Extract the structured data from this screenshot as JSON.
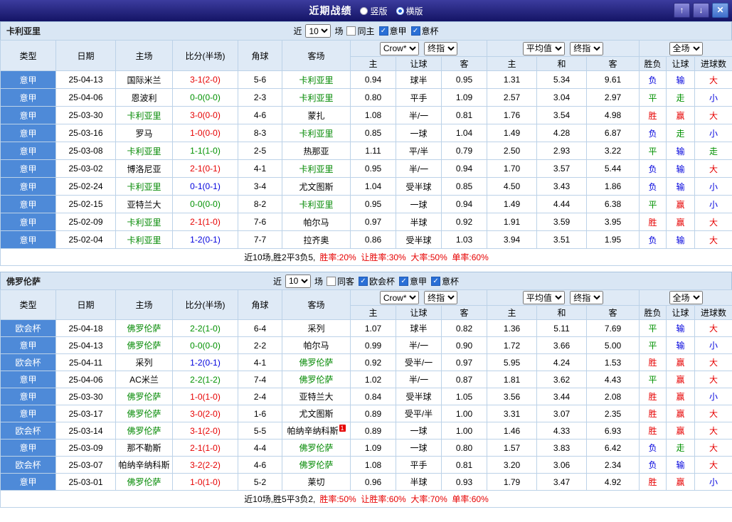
{
  "topbar": {
    "title": "近期战绩",
    "vertical_label": "竖版",
    "horizontal_label": "横版",
    "selected_layout": "横版",
    "up_glyph": "↑",
    "down_glyph": "↓",
    "close_glyph": "✕"
  },
  "table": {
    "col_headers": {
      "type": "类型",
      "date": "日期",
      "home": "主场",
      "score": "比分(半场)",
      "corner": "角球",
      "away": "客场"
    },
    "sub_headers": [
      "主",
      "让球",
      "客",
      "主",
      "和",
      "客",
      "胜负",
      "让球",
      "进球数"
    ],
    "selects": {
      "company": "Crow*",
      "final_a": "终指",
      "average": "平均值",
      "final_b": "终指",
      "scope": "全场"
    },
    "filter": {
      "near": "近",
      "matches": "场"
    }
  },
  "colors": {
    "red": "#e60000",
    "green": "#009100",
    "blue": "#0000dd",
    "team": "#008800",
    "league_bg": "#4e8ad8"
  },
  "sections": [
    {
      "team": "卡利亚里",
      "filter_count": "10",
      "checkboxes": [
        {
          "label": "同主",
          "checked": false
        },
        {
          "label": "意甲",
          "checked": true
        },
        {
          "label": "意杯",
          "checked": true
        }
      ],
      "rows": [
        {
          "league": "意甲",
          "date": "25-04-13",
          "home": "国际米兰",
          "home_self": false,
          "score": "3-1(2-0)",
          "result": "home",
          "corner": "5-6",
          "away": "卡利亚里",
          "away_self": true,
          "badge": "",
          "o1": "0.94",
          "hc": "球半",
          "o2": "0.95",
          "a1": "1.31",
          "a2": "5.34",
          "a3": "9.61",
          "r1": "负",
          "r2": "输",
          "r3": "大"
        },
        {
          "league": "意甲",
          "date": "25-04-06",
          "home": "恩波利",
          "home_self": false,
          "score": "0-0(0-0)",
          "result": "draw",
          "corner": "2-3",
          "away": "卡利亚里",
          "away_self": true,
          "badge": "",
          "o1": "0.80",
          "hc": "平手",
          "o2": "1.09",
          "a1": "2.57",
          "a2": "3.04",
          "a3": "2.97",
          "r1": "平",
          "r2": "走",
          "r3": "小"
        },
        {
          "league": "意甲",
          "date": "25-03-30",
          "home": "卡利亚里",
          "home_self": true,
          "score": "3-0(0-0)",
          "result": "home",
          "corner": "4-6",
          "away": "蒙扎",
          "away_self": false,
          "badge": "",
          "o1": "1.08",
          "hc": "半/一",
          "o2": "0.81",
          "a1": "1.76",
          "a2": "3.54",
          "a3": "4.98",
          "r1": "胜",
          "r2": "赢",
          "r3": "大"
        },
        {
          "league": "意甲",
          "date": "25-03-16",
          "home": "罗马",
          "home_self": false,
          "score": "1-0(0-0)",
          "result": "home",
          "corner": "8-3",
          "away": "卡利亚里",
          "away_self": true,
          "badge": "",
          "o1": "0.85",
          "hc": "一球",
          "o2": "1.04",
          "a1": "1.49",
          "a2": "4.28",
          "a3": "6.87",
          "r1": "负",
          "r2": "走",
          "r3": "小"
        },
        {
          "league": "意甲",
          "date": "25-03-08",
          "home": "卡利亚里",
          "home_self": true,
          "score": "1-1(1-0)",
          "result": "draw",
          "corner": "2-5",
          "away": "热那亚",
          "away_self": false,
          "badge": "",
          "o1": "1.11",
          "hc": "平/半",
          "o2": "0.79",
          "a1": "2.50",
          "a2": "2.93",
          "a3": "3.22",
          "r1": "平",
          "r2": "输",
          "r3": "走"
        },
        {
          "league": "意甲",
          "date": "25-03-02",
          "home": "博洛尼亚",
          "home_self": false,
          "score": "2-1(0-1)",
          "result": "home",
          "corner": "4-1",
          "away": "卡利亚里",
          "away_self": true,
          "badge": "",
          "o1": "0.95",
          "hc": "半/一",
          "o2": "0.94",
          "a1": "1.70",
          "a2": "3.57",
          "a3": "5.44",
          "r1": "负",
          "r2": "输",
          "r3": "大"
        },
        {
          "league": "意甲",
          "date": "25-02-24",
          "home": "卡利亚里",
          "home_self": true,
          "score": "0-1(0-1)",
          "result": "away",
          "corner": "3-4",
          "away": "尤文图斯",
          "away_self": false,
          "badge": "",
          "o1": "1.04",
          "hc": "受半球",
          "o2": "0.85",
          "a1": "4.50",
          "a2": "3.43",
          "a3": "1.86",
          "r1": "负",
          "r2": "输",
          "r3": "小"
        },
        {
          "league": "意甲",
          "date": "25-02-15",
          "home": "亚特兰大",
          "home_self": false,
          "score": "0-0(0-0)",
          "result": "draw",
          "corner": "8-2",
          "away": "卡利亚里",
          "away_self": true,
          "badge": "",
          "o1": "0.95",
          "hc": "一球",
          "o2": "0.94",
          "a1": "1.49",
          "a2": "4.44",
          "a3": "6.38",
          "r1": "平",
          "r2": "赢",
          "r3": "小"
        },
        {
          "league": "意甲",
          "date": "25-02-09",
          "home": "卡利亚里",
          "home_self": true,
          "score": "2-1(1-0)",
          "result": "home",
          "corner": "7-6",
          "away": "帕尔马",
          "away_self": false,
          "badge": "",
          "o1": "0.97",
          "hc": "半球",
          "o2": "0.92",
          "a1": "1.91",
          "a2": "3.59",
          "a3": "3.95",
          "r1": "胜",
          "r2": "赢",
          "r3": "大"
        },
        {
          "league": "意甲",
          "date": "25-02-04",
          "home": "卡利亚里",
          "home_self": true,
          "score": "1-2(0-1)",
          "result": "away",
          "corner": "7-7",
          "away": "拉齐奥",
          "away_self": false,
          "badge": "",
          "o1": "0.86",
          "hc": "受半球",
          "o2": "1.03",
          "a1": "3.94",
          "a2": "3.51",
          "a3": "1.95",
          "r1": "负",
          "r2": "输",
          "r3": "大"
        }
      ],
      "summary_prefix": "近10场,胜2平3负5,",
      "summary_stats": "胜率:20%  让胜率:30%  大率:50%  单率:60%"
    },
    {
      "team": "佛罗伦萨",
      "filter_count": "10",
      "checkboxes": [
        {
          "label": "同客",
          "checked": false
        },
        {
          "label": "欧会杯",
          "checked": true
        },
        {
          "label": "意甲",
          "checked": true
        },
        {
          "label": "意杯",
          "checked": true
        }
      ],
      "rows": [
        {
          "league": "欧会杯",
          "date": "25-04-18",
          "home": "佛罗伦萨",
          "home_self": true,
          "score": "2-2(1-0)",
          "result": "draw",
          "corner": "6-4",
          "away": "采列",
          "away_self": false,
          "badge": "",
          "o1": "1.07",
          "hc": "球半",
          "o2": "0.82",
          "a1": "1.36",
          "a2": "5.11",
          "a3": "7.69",
          "r1": "平",
          "r2": "输",
          "r3": "大"
        },
        {
          "league": "意甲",
          "date": "25-04-13",
          "home": "佛罗伦萨",
          "home_self": true,
          "score": "0-0(0-0)",
          "result": "draw",
          "corner": "2-2",
          "away": "帕尔马",
          "away_self": false,
          "badge": "",
          "o1": "0.99",
          "hc": "半/一",
          "o2": "0.90",
          "a1": "1.72",
          "a2": "3.66",
          "a3": "5.00",
          "r1": "平",
          "r2": "输",
          "r3": "小"
        },
        {
          "league": "欧会杯",
          "date": "25-04-11",
          "home": "采列",
          "home_self": false,
          "score": "1-2(0-1)",
          "result": "away",
          "corner": "4-1",
          "away": "佛罗伦萨",
          "away_self": true,
          "badge": "",
          "o1": "0.92",
          "hc": "受半/一",
          "o2": "0.97",
          "a1": "5.95",
          "a2": "4.24",
          "a3": "1.53",
          "r1": "胜",
          "r2": "赢",
          "r3": "大"
        },
        {
          "league": "意甲",
          "date": "25-04-06",
          "home": "AC米兰",
          "home_self": false,
          "score": "2-2(1-2)",
          "result": "draw",
          "corner": "7-4",
          "away": "佛罗伦萨",
          "away_self": true,
          "badge": "",
          "o1": "1.02",
          "hc": "半/一",
          "o2": "0.87",
          "a1": "1.81",
          "a2": "3.62",
          "a3": "4.43",
          "r1": "平",
          "r2": "赢",
          "r3": "大"
        },
        {
          "league": "意甲",
          "date": "25-03-30",
          "home": "佛罗伦萨",
          "home_self": true,
          "score": "1-0(1-0)",
          "result": "home",
          "corner": "2-4",
          "away": "亚特兰大",
          "away_self": false,
          "badge": "",
          "o1": "0.84",
          "hc": "受半球",
          "o2": "1.05",
          "a1": "3.56",
          "a2": "3.44",
          "a3": "2.08",
          "r1": "胜",
          "r2": "赢",
          "r3": "小"
        },
        {
          "league": "意甲",
          "date": "25-03-17",
          "home": "佛罗伦萨",
          "home_self": true,
          "score": "3-0(2-0)",
          "result": "home",
          "corner": "1-6",
          "away": "尤文图斯",
          "away_self": false,
          "badge": "",
          "o1": "0.89",
          "hc": "受平/半",
          "o2": "1.00",
          "a1": "3.31",
          "a2": "3.07",
          "a3": "2.35",
          "r1": "胜",
          "r2": "赢",
          "r3": "大"
        },
        {
          "league": "欧会杯",
          "date": "25-03-14",
          "home": "佛罗伦萨",
          "home_self": true,
          "score": "3-1(2-0)",
          "result": "home",
          "corner": "5-5",
          "away": "帕纳辛纳科斯",
          "away_self": false,
          "badge": "1",
          "o1": "0.89",
          "hc": "一球",
          "o2": "1.00",
          "a1": "1.46",
          "a2": "4.33",
          "a3": "6.93",
          "r1": "胜",
          "r2": "赢",
          "r3": "大"
        },
        {
          "league": "意甲",
          "date": "25-03-09",
          "home": "那不勒斯",
          "home_self": false,
          "score": "2-1(1-0)",
          "result": "home",
          "corner": "4-4",
          "away": "佛罗伦萨",
          "away_self": true,
          "badge": "",
          "o1": "1.09",
          "hc": "一球",
          "o2": "0.80",
          "a1": "1.57",
          "a2": "3.83",
          "a3": "6.42",
          "r1": "负",
          "r2": "走",
          "r3": "大"
        },
        {
          "league": "欧会杯",
          "date": "25-03-07",
          "home": "帕纳辛纳科斯",
          "home_self": false,
          "score": "3-2(2-2)",
          "result": "home",
          "corner": "4-6",
          "away": "佛罗伦萨",
          "away_self": true,
          "badge": "",
          "o1": "1.08",
          "hc": "平手",
          "o2": "0.81",
          "a1": "3.20",
          "a2": "3.06",
          "a3": "2.34",
          "r1": "负",
          "r2": "输",
          "r3": "大"
        },
        {
          "league": "意甲",
          "date": "25-03-01",
          "home": "佛罗伦萨",
          "home_self": true,
          "score": "1-0(1-0)",
          "result": "home",
          "corner": "5-2",
          "away": "莱切",
          "away_self": false,
          "badge": "",
          "o1": "0.96",
          "hc": "半球",
          "o2": "0.93",
          "a1": "1.79",
          "a2": "3.47",
          "a3": "4.92",
          "r1": "胜",
          "r2": "赢",
          "r3": "小"
        }
      ],
      "summary_prefix": "近10场,胜5平3负2,",
      "summary_stats": "胜率:50%  让胜率:60%  大率:70%  单率:60%"
    }
  ]
}
